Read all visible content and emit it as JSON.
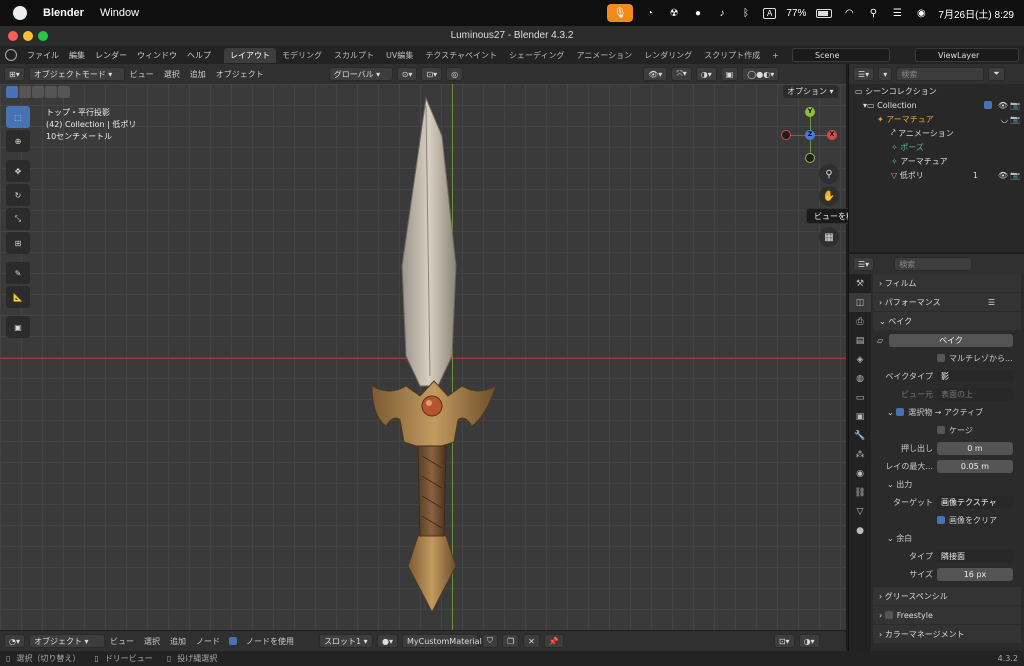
{
  "menubar": {
    "app": "Blender",
    "window_menu": "Window",
    "battery": "77%",
    "date_time": "7月26日(土) 8:29",
    "box_label": "A"
  },
  "window": {
    "title": "Luminous27 - Blender 4.3.2"
  },
  "topbar": {
    "menus": [
      "ファイル",
      "編集",
      "レンダー",
      "ウィンドウ",
      "ヘルプ"
    ],
    "workspaces": [
      "レイアウト",
      "モデリング",
      "スカルプト",
      "UV編集",
      "テクスチャペイント",
      "シェーディング",
      "アニメーション",
      "レンダリング",
      "スクリプト作成"
    ],
    "add_tab": "+",
    "scene": "Scene",
    "view_layer": "ViewLayer"
  },
  "viewport_header": {
    "mode": "オブジェクトモード",
    "menus": [
      "ビュー",
      "選択",
      "追加",
      "オブジェクト"
    ],
    "transform": "グローバル"
  },
  "overlay_text": {
    "view_name": "トップ・平行投影",
    "collection": "(42) Collection | 低ポリ",
    "scale": "10センチメートル"
  },
  "options_button": "オプション",
  "tooltip": "ビューを移動します",
  "gizmo": {
    "y": "Y",
    "x": "X",
    "z": "Z"
  },
  "viewport_footer": {
    "editor": "オブジェクト",
    "menus": [
      "ビュー",
      "選択",
      "追加",
      "ノード"
    ],
    "use_nodes": "ノードを使用",
    "slot": "スロット1",
    "material": "MyCustomMaterial"
  },
  "statusbar": {
    "select": "選択（切り替え）",
    "drag": "ドリービュー",
    "lasso": "投げ縄選択",
    "version": "4.3.2"
  },
  "outliner": {
    "search_placeholder": "検索",
    "rows": [
      {
        "label": "シーンコレクション"
      },
      {
        "label": "Collection"
      },
      {
        "label": "アーマチュア"
      },
      {
        "label": "アニメーション"
      },
      {
        "label": "ポーズ"
      },
      {
        "label": "アーマチュア"
      },
      {
        "label": "低ポリ",
        "badge": "1"
      }
    ]
  },
  "properties": {
    "search_placeholder": "検索",
    "film": "フィルム",
    "performance": "パフォーマンス",
    "bake": "ベイク",
    "bake_button": "ベイク",
    "multires": "マルチレゾから...",
    "bake_type_label": "ベイクタイプ",
    "bake_type": "影",
    "view_from_label": "ビュー元",
    "view_from": "表面の上",
    "selected_to_active": "選択物 → アクティブ",
    "cage": "ケージ",
    "extrusion_label": "押し出し",
    "extrusion": "0 m",
    "max_ray_label": "レイの最大...",
    "max_ray": "0.05 m",
    "output": "出力",
    "target_label": "ターゲット",
    "target": "画像テクスチャ",
    "clear_image": "画像をクリア",
    "margin": "余白",
    "type_label": "タイプ",
    "type": "隣接面",
    "size_label": "サイズ",
    "size": "16 px",
    "grease_pencil": "グリースペンシル",
    "freestyle": "Freestyle",
    "color_management": "カラーマネージメント"
  },
  "colors": {
    "accent": "#4772b3",
    "mic": "#f08a1c",
    "x_axis": "#9a3b3b",
    "y_axis": "#6f8f3a"
  }
}
